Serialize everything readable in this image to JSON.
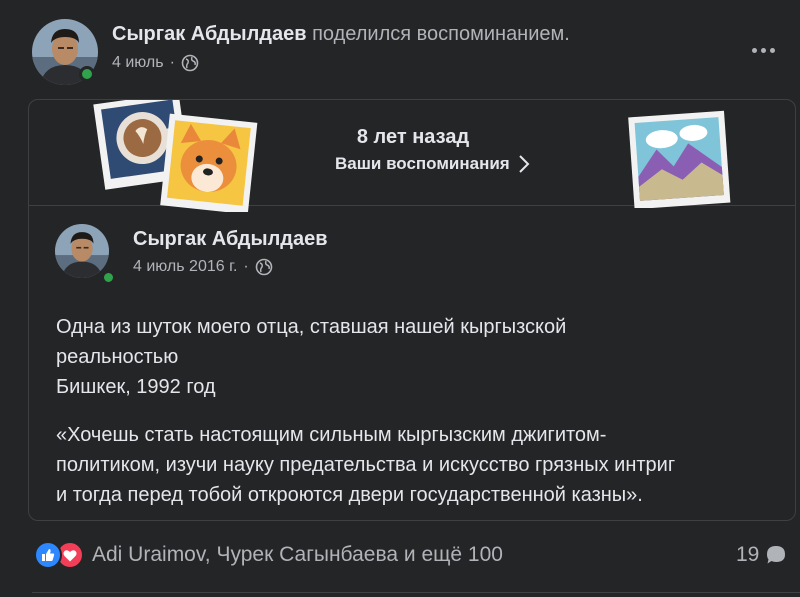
{
  "post": {
    "author": "Сыргак Абдылдаев",
    "action": "поделился воспоминанием.",
    "date": "4 июль",
    "separator": "·",
    "privacy_icon": "globe-icon",
    "more_icon": "more-horizontal-icon"
  },
  "memory": {
    "years_ago": "8 лет назад",
    "link_label": "Ваши воспоминания",
    "link_icon": "chevron-right-icon",
    "decorations": [
      "coffee-photo-icon",
      "dog-photo-icon",
      "mountain-photo-icon"
    ]
  },
  "original": {
    "author": "Сыргак Абдылдаев",
    "date": "4 июль 2016 г.",
    "separator": "·",
    "privacy_icon": "globe-icon",
    "text_lines": [
      "Одна из шуток моего отца, ставшая нашей кыргызской",
      "реальностью",
      "Бишкек, 1992 год"
    ],
    "quote_lines": [
      "«Хочешь стать настоящим сильным кыргызским джигитом-",
      "политиком, изучи науку предательства и искусство грязных интриг",
      "и тогда перед тобой откроются двери государственной казны»."
    ]
  },
  "footer": {
    "reactions_text": "Adi Uraimov, Чурек Сагынбаева и ещё 100",
    "reaction_icons": [
      "like-icon",
      "love-icon"
    ],
    "comment_count": "19",
    "comment_icon": "comment-icon"
  },
  "colors": {
    "background": "#242526",
    "text_primary": "#e4e6eb",
    "text_secondary": "#b0b3b8",
    "border": "#3e4042",
    "online": "#31a24c",
    "like": "#2d88ff",
    "love": "#f33e58"
  }
}
